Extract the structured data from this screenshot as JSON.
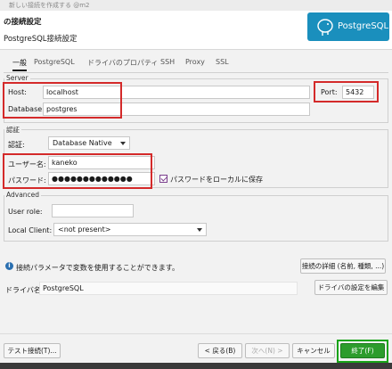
{
  "window": {
    "title": "新しい接続を作成する @m2"
  },
  "header": {
    "title": "の接続設定",
    "subtitle": "PostgreSQL接続設定",
    "logo_text": "PostgreSQL"
  },
  "tabs": [
    {
      "label": "一般",
      "active": true
    },
    {
      "label": "PostgreSQL"
    },
    {
      "label": "ドライバのプロパティ"
    },
    {
      "label": "SSH"
    },
    {
      "label": "Proxy"
    },
    {
      "label": "SSL"
    }
  ],
  "server": {
    "legend": "Server",
    "host_label": "Host:",
    "host_value": "localhost",
    "port_label": "Port:",
    "port_value": "5432",
    "database_label": "Database:",
    "database_value": "postgres"
  },
  "auth": {
    "legend": "認証",
    "method_label": "認証:",
    "method_value": "Database Native",
    "username_label": "ユーザー名:",
    "username_value": "kaneko",
    "password_label": "パスワード:",
    "password_value": "●●●●●●●●●●●●●",
    "save_password_label": "パスワードをローカルに保存",
    "save_password_checked": true
  },
  "advanced": {
    "legend": "Advanced",
    "user_role_label": "User role:",
    "user_role_value": "",
    "local_client_label": "Local Client:",
    "local_client_value": "<not present>"
  },
  "info": {
    "text": "接続パラメータで変数を使用することができます。",
    "details_button": "接続の詳細 (名前, 種類, ...)"
  },
  "driver": {
    "label": "ドライバ名:",
    "value": "PostgreSQL",
    "edit_button": "ドライバの設定を編集"
  },
  "footer": {
    "test_button": "テスト接続(T)...",
    "back_button": "< 戻る(B)",
    "next_button": "次へ(N) >",
    "cancel_button": "キャンセル",
    "finish_button": "終了(F)"
  },
  "colors": {
    "logo_bg": "#1a8fbd",
    "highlight_red": "#d42a2a",
    "highlight_green": "#18a318",
    "finish_button": "#2c9c2c"
  }
}
